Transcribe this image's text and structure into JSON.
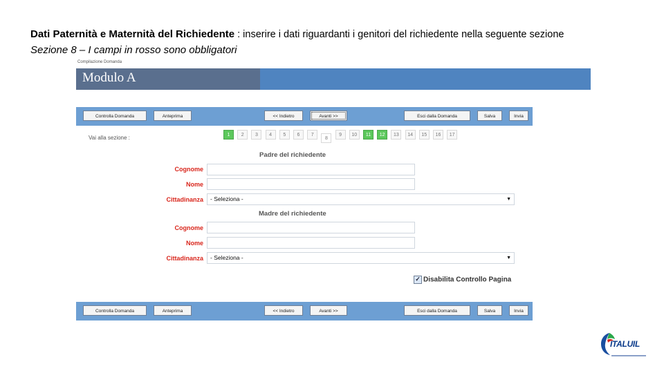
{
  "slide": {
    "heading_bold": "Dati Paternità e Maternità del Richiedente",
    "heading_rest": " : inserire i dati riguardanti i genitori del richiedente nella seguente sezione",
    "subheading": "Sezione 8 – I campi in rosso sono obbligatori"
  },
  "app": {
    "breadcrumb": "Compilazione Domanda",
    "title": "Modulo A"
  },
  "toolbar": {
    "controlla": "Controlla Domanda",
    "anteprima": "Anteprima",
    "indietro": "<< Indietro",
    "avanti": "Avanti >>",
    "esci": "Esci dalla Domanda",
    "salva": "Salva",
    "invia": "Invia"
  },
  "nav": {
    "label": "Vai alla sezione :",
    "pages": [
      "1",
      "2",
      "3",
      "4",
      "5",
      "6",
      "7",
      "8",
      "9",
      "10",
      "11",
      "12",
      "13",
      "14",
      "15",
      "16",
      "17"
    ],
    "completed": [
      "1",
      "11",
      "12"
    ],
    "current": "8"
  },
  "padre": {
    "title": "Padre del richiedente",
    "cognome_label": "Cognome",
    "cognome_value": "",
    "nome_label": "Nome",
    "nome_value": "",
    "cittadinanza_label": "Cittadinanza",
    "cittadinanza_value": "- Seleziona -"
  },
  "madre": {
    "title": "Madre del richiedente",
    "cognome_label": "Cognome",
    "cognome_value": "",
    "nome_label": "Nome",
    "nome_value": "",
    "cittadinanza_label": "Cittadinanza",
    "cittadinanza_value": "- Seleziona -"
  },
  "options": {
    "disabilita_label": "Disabilita Controllo Pagina",
    "disabilita_checked": true
  },
  "logo": {
    "text": "ITALUIL"
  },
  "colors": {
    "banner": "#4f84c0",
    "toolbar": "#6d9fd3",
    "required_label": "#d9261c",
    "completed_page": "#5cc85c"
  }
}
